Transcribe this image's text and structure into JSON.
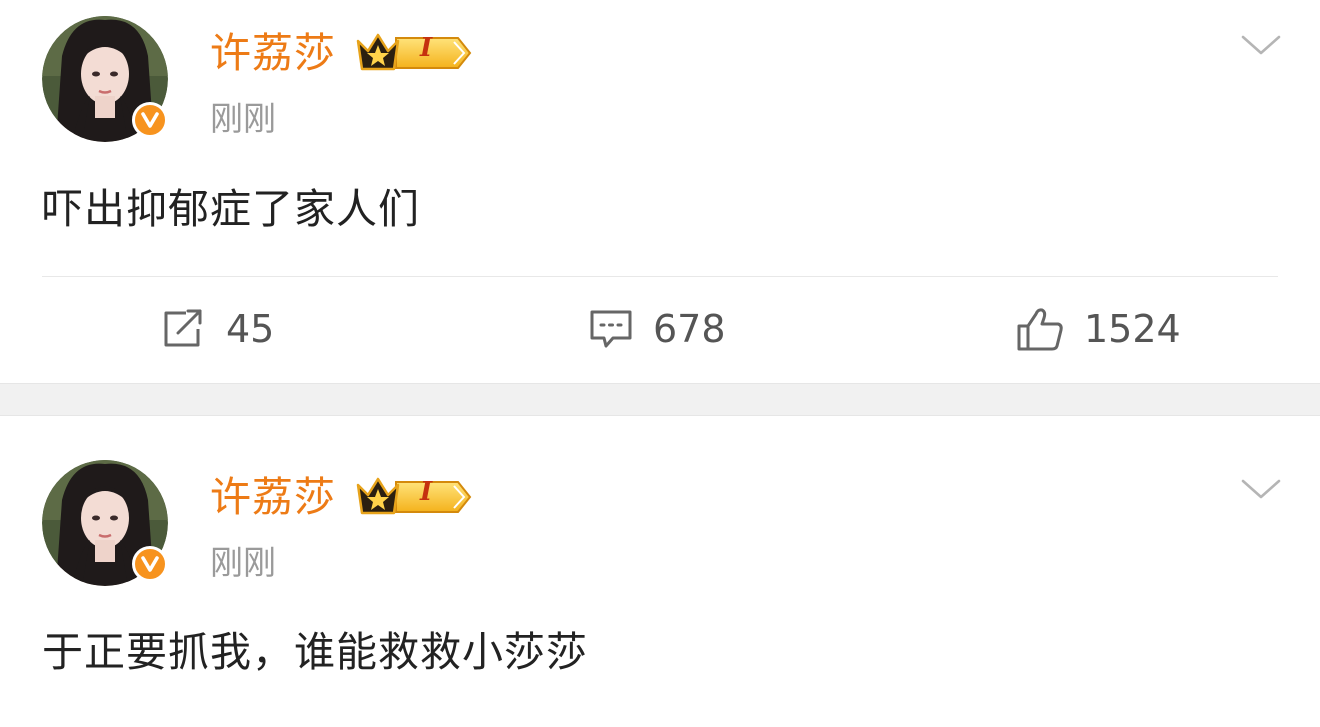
{
  "posts": [
    {
      "username": "许荔莎",
      "vip_level": "I",
      "timestamp": "刚刚",
      "content": "吓出抑郁症了家人们",
      "actions": {
        "repost_count": "45",
        "comment_count": "678",
        "like_count": "1524"
      }
    },
    {
      "username": "许荔莎",
      "vip_level": "I",
      "timestamp": "刚刚",
      "content": "于正要抓我，谁能救救小莎莎"
    }
  ],
  "colors": {
    "username": "#ed7b16",
    "verified_badge": "#f7931e",
    "timestamp": "#9a9a9a",
    "content": "#222222",
    "separator": "#f1f1f1"
  },
  "icons": [
    "avatar",
    "verified-icon",
    "vip-crown-icon",
    "chevron-down-icon",
    "repost-icon",
    "comment-icon",
    "like-icon"
  ]
}
